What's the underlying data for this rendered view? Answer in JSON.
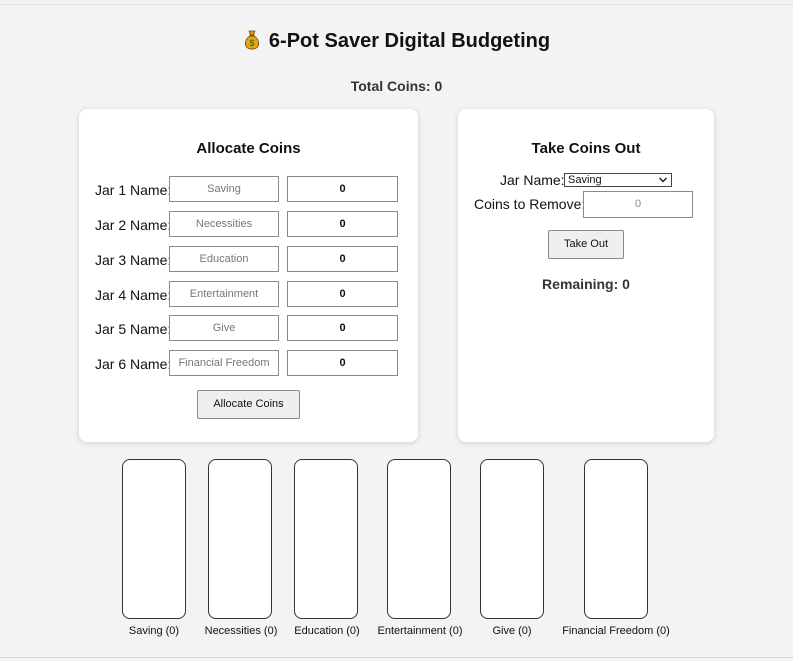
{
  "header": {
    "title": "6-Pot Saver Digital Budgeting",
    "title_icon": "money-bag-icon",
    "total_label": "Total Coins: 0"
  },
  "allocate": {
    "heading": "Allocate Coins",
    "jars": [
      {
        "label": "Jar 1 Name:",
        "name_placeholder": "Saving",
        "amount": "0"
      },
      {
        "label": "Jar 2 Name:",
        "name_placeholder": "Necessities",
        "amount": "0"
      },
      {
        "label": "Jar 3 Name:",
        "name_placeholder": "Education",
        "amount": "0"
      },
      {
        "label": "Jar 4 Name:",
        "name_placeholder": "Entertainment",
        "amount": "0"
      },
      {
        "label": "Jar 5 Name:",
        "name_placeholder": "Give",
        "amount": "0"
      },
      {
        "label": "Jar 6 Name:",
        "name_placeholder": "Financial Freedom",
        "amount": "0"
      }
    ],
    "button_label": "Allocate Coins"
  },
  "take_out": {
    "heading": "Take Coins Out",
    "jar_name_label": "Jar Name:",
    "selected_jar": "Saving",
    "coins_label": "Coins to Remove:",
    "coins_placeholder": "0",
    "button_label": "Take Out",
    "remaining": "Remaining: 0"
  },
  "pots": [
    {
      "label": "Saving (0)"
    },
    {
      "label": "Necessities (0)"
    },
    {
      "label": "Education (0)"
    },
    {
      "label": "Entertainment (0)"
    },
    {
      "label": "Give (0)"
    },
    {
      "label": "Financial Freedom (0)"
    }
  ],
  "colors": {
    "background": "#f3f3f3",
    "card": "#ffffff",
    "button": "#efefef",
    "money_bag": "#e8a317"
  }
}
